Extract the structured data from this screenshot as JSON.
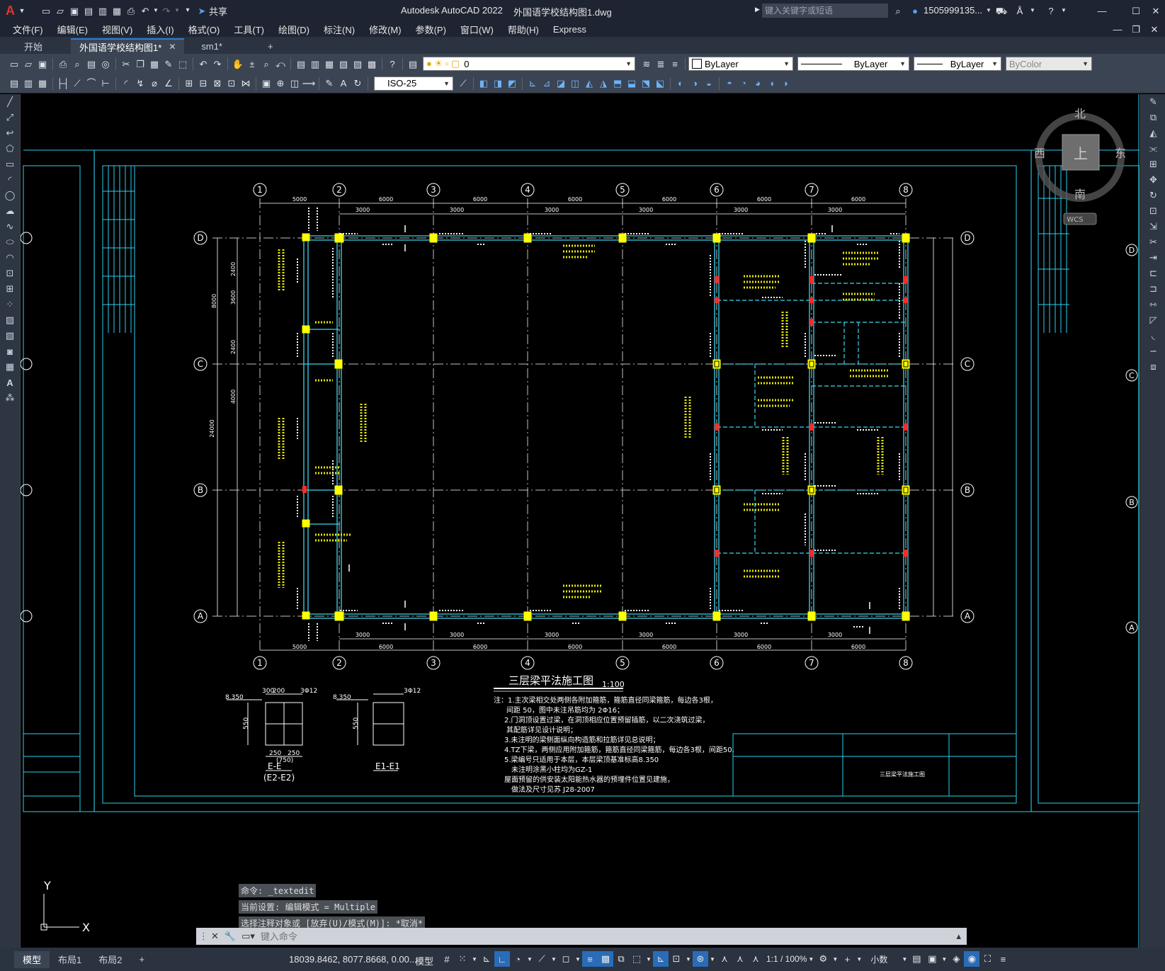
{
  "titlebar": {
    "app_name": "Autodesk AutoCAD 2022",
    "filename": "外国语学校结构图1.dwg",
    "share_label": "共享",
    "search_placeholder": "键入关键字或短语",
    "user": "1505999135...",
    "window_min": "—",
    "window_max": "☐",
    "window_close": "✕"
  },
  "menu": [
    "文件(F)",
    "编辑(E)",
    "视图(V)",
    "插入(I)",
    "格式(O)",
    "工具(T)",
    "绘图(D)",
    "标注(N)",
    "修改(M)",
    "参数(P)",
    "窗口(W)",
    "帮助(H)",
    "Express"
  ],
  "tabs": [
    {
      "label": "开始",
      "active": false,
      "closable": false
    },
    {
      "label": "外国语学校结构图1*",
      "active": true,
      "closable": true
    },
    {
      "label": "sm1*",
      "active": false,
      "closable": false
    }
  ],
  "tab_add": "+",
  "toolbar": {
    "layer_value": "0",
    "color_value": "ByLayer",
    "linetype_value": "ByLayer",
    "lineweight_value": "ByLayer",
    "plotstyle_value": "ByColor",
    "dimstyle_value": "ISO-25"
  },
  "viewcube": {
    "north": "北",
    "south": "南",
    "east": "东",
    "west": "西",
    "top": "上",
    "wcs": "WCS"
  },
  "drawing": {
    "grid_cols": [
      "1",
      "2",
      "3",
      "4",
      "5",
      "6",
      "7",
      "8"
    ],
    "grid_rows": [
      "D",
      "C",
      "B",
      "A"
    ],
    "span_top": [
      "5000",
      "6000",
      "6000",
      "6000",
      "6000",
      "6000",
      "6000"
    ],
    "sub_dims": [
      "3000",
      "3000",
      "3000",
      "3000",
      "3000",
      "3000"
    ],
    "side_dims": [
      "2400",
      "3600",
      "8000",
      "2400",
      "4000",
      "24000"
    ],
    "title": "三层梁平法施工图",
    "scale": "1:100",
    "notes": [
      "注：1.主次梁相交处两侧各附加箍筋，箍筋直径同梁箍筋，每边各3根，",
      "间距 50，图中未注吊筋均为 2Φ16；",
      "2.门洞顶设置过梁，在洞顶相应位置预留插筋，以二次浇筑过梁，",
      "其配筋详见设计说明；",
      "3.未注明的梁侧面纵向构造筋和拉筋详见总说明；",
      "4.TZ下梁，两侧应用附加箍筋，箍筋直径同梁箍筋，每边各3根，间距50.",
      "5.梁编号只适用于本层，本层梁顶基准标高8.350",
      "未注明涂黑小柱均为GZ-1",
      "屋面预留的供安装太阳能热水器的预埋件位置见建施，",
      "做法及尺寸见苏 J28-2007"
    ],
    "section1_label": "E-E",
    "section1_sub": "(E2-E2)",
    "section2_label": "E1-E1",
    "section_elev": "8.350",
    "section_dims": [
      "300",
      "200",
      "3Φ12",
      "550",
      "250",
      "250",
      "(750)"
    ],
    "titleblock_text": "三层梁平法施工图",
    "ucs_x": "X",
    "ucs_y": "Y"
  },
  "command": {
    "history": [
      "命令: _textedit",
      "当前设置: 编辑模式 = Multiple",
      "选择注释对象或 [放弃(U)/模式(M)]: *取消*"
    ],
    "placeholder": "键入命令"
  },
  "status": {
    "tabs": [
      "模型",
      "布局1",
      "布局2"
    ],
    "coords": "18039.8462, 8077.8668, 0.00...",
    "model_label": "模型",
    "scale": "1:1 / 100%",
    "units": "小数"
  }
}
